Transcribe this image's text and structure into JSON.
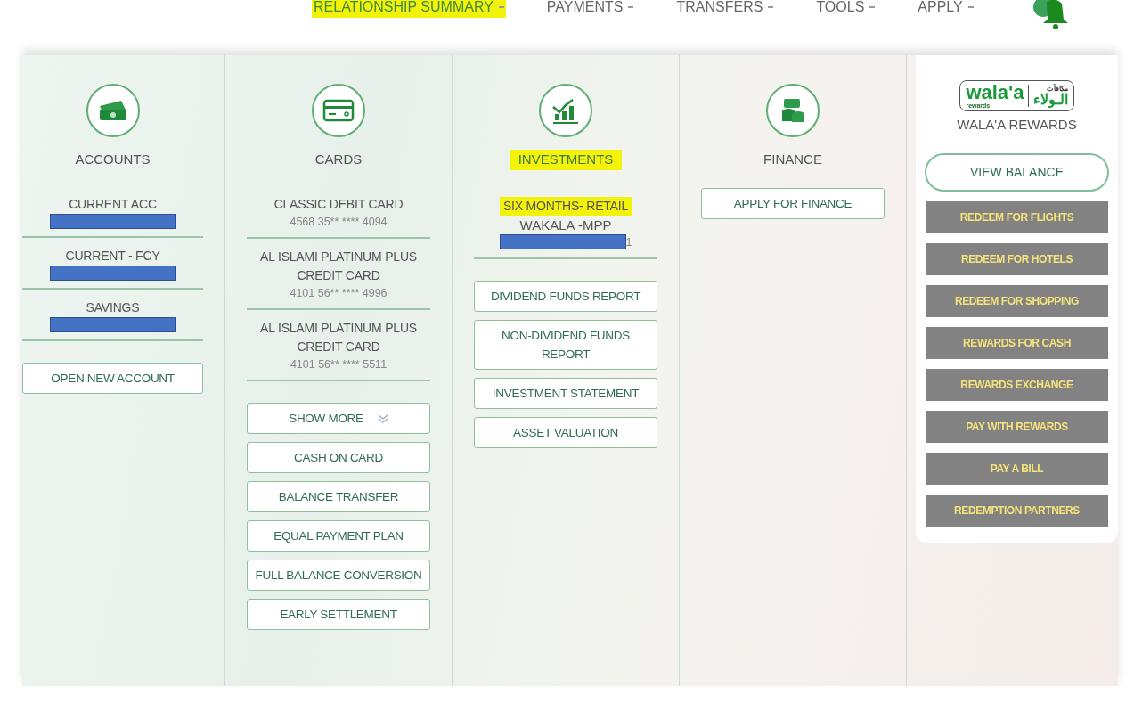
{
  "nav": {
    "items": [
      {
        "label": "RELATIONSHIP SUMMARY",
        "highlighted": true
      },
      {
        "label": "PAYMENTS",
        "highlighted": false
      },
      {
        "label": "TRANSFERS",
        "highlighted": false
      },
      {
        "label": "TOOLS",
        "highlighted": false
      },
      {
        "label": "APPLY",
        "highlighted": false
      }
    ]
  },
  "columns": [
    {
      "kind": "accounts",
      "title": "ACCOUNTS",
      "highlighted": false,
      "entries": [
        {
          "title": "CURRENT ACC",
          "masked": true
        },
        {
          "title": "CURRENT - FCY",
          "masked": true
        },
        {
          "title": "SAVINGS",
          "masked": true
        }
      ],
      "buttons": [
        {
          "label": "OPEN NEW ACCOUNT",
          "kind": "plain"
        }
      ]
    },
    {
      "kind": "cards",
      "title": "CARDS",
      "highlighted": false,
      "entries": [
        {
          "title": "CLASSIC DEBIT CARD",
          "number": "4568 35** **** 4094"
        },
        {
          "title": "AL ISLAMI PLATINUM PLUS CREDIT CARD",
          "number": "4101 56** **** 4996"
        },
        {
          "title": "AL ISLAMI PLATINUM PLUS CREDIT CARD",
          "number": "4101 56** **** 5511"
        }
      ],
      "buttons": [
        {
          "label": "SHOW MORE",
          "kind": "expand"
        },
        {
          "label": "CASH ON CARD",
          "kind": "plain"
        },
        {
          "label": "BALANCE TRANSFER",
          "kind": "plain"
        },
        {
          "label": "EQUAL PAYMENT PLAN",
          "kind": "plain"
        },
        {
          "label": "FULL BALANCE CONVERSION",
          "kind": "plain"
        },
        {
          "label": "EARLY SETTLEMENT",
          "kind": "plain"
        }
      ]
    },
    {
      "kind": "investments",
      "title": "INVESTMENTS",
      "highlighted": true,
      "entries": [
        {
          "title": "SIX MONTHS- RETAIL",
          "highlighted": true,
          "subtitle": "WAKALA -MPP",
          "masked": true,
          "number": "1"
        }
      ],
      "buttons": [
        {
          "label": "DIVIDEND FUNDS REPORT",
          "kind": "plain"
        },
        {
          "label": "NON-DIVIDEND FUNDS REPORT",
          "kind": "plain"
        },
        {
          "label": "INVESTMENT STATEMENT",
          "kind": "plain"
        },
        {
          "label": "ASSET VALUATION",
          "kind": "plain"
        }
      ]
    },
    {
      "kind": "finance",
      "title": "FINANCE",
      "highlighted": false,
      "buttons": [
        {
          "label": "APPLY FOR FINANCE",
          "kind": "plain"
        }
      ]
    }
  ],
  "rewards": {
    "logo": {
      "latin": "wala'a",
      "sub": "rewards",
      "arabic": "الـولاء",
      "arabic_top": "مكافآت"
    },
    "title": "WALA'A REWARDS",
    "primary_button": "VIEW BALANCE",
    "actions": [
      "REDEEM FOR FLIGHTS",
      "REDEEM FOR HOTELS",
      "REDEEM FOR SHOPPING",
      "REWARDS FOR CASH",
      "REWARDS EXCHANGE",
      "PAY WITH REWARDS",
      "PAY A BILL",
      "REDEMPTION PARTNERS"
    ]
  }
}
